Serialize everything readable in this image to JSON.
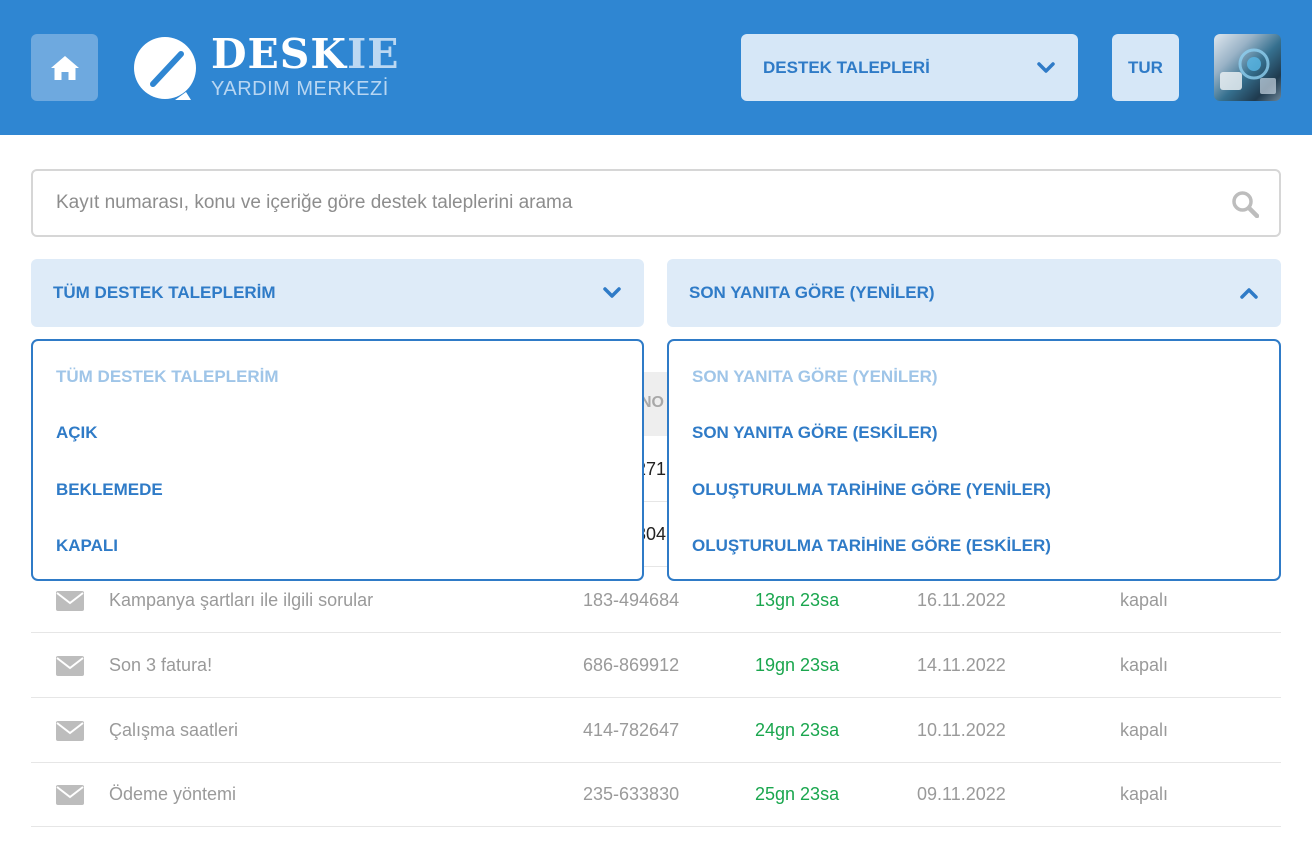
{
  "brand": {
    "name_main": "DESK",
    "name_accent": "IE",
    "subtitle": "YARDIM MERKEZİ"
  },
  "header": {
    "nav_select_label": "DESTEK TALEPLERİ",
    "language": "TUR"
  },
  "search": {
    "placeholder": "Kayıt numarası, konu ve içeriğe göre destek taleplerini arama"
  },
  "filters": {
    "status_label": "TÜM DESTEK TALEPLERİM",
    "sort_label": "SON YANITA GÖRE (YENİLER)"
  },
  "status_options": [
    "TÜM DESTEK TALEPLERİM",
    "AÇIK",
    "BEKLEMEDE",
    "KAPALI"
  ],
  "sort_options": [
    "SON YANITA GÖRE (YENİLER)",
    "SON YANITA GÖRE (ESKİLER)",
    "OLUŞTURULMA TARİHİNE GÖRE (YENİLER)",
    "OLUŞTURULMA TARİHİNE GÖRE (ESKİLER)"
  ],
  "table": {
    "header_fragment": "NO",
    "hidden_rows": [
      {
        "ticket_fragment": "271"
      },
      {
        "ticket_fragment": "304"
      }
    ],
    "rows": [
      {
        "subject": "Kampanya şartları ile ilgili sorular",
        "ticket": "183-494684",
        "elapsed": "13gn 23sa",
        "date": "16.11.2022",
        "status": "kapalı"
      },
      {
        "subject": "Son 3 fatura!",
        "ticket": "686-869912",
        "elapsed": "19gn 23sa",
        "date": "14.11.2022",
        "status": "kapalı"
      },
      {
        "subject": "Çalışma saatleri",
        "ticket": "414-782647",
        "elapsed": "24gn 23sa",
        "date": "10.11.2022",
        "status": "kapalı"
      },
      {
        "subject": "Ödeme yöntemi",
        "ticket": "235-633830",
        "elapsed": "25gn 23sa",
        "date": "09.11.2022",
        "status": "kapalı"
      }
    ]
  },
  "colors": {
    "header_bg": "#2f86d2",
    "accent": "#2f7bc7",
    "elapsed_green": "#1aa64e"
  }
}
